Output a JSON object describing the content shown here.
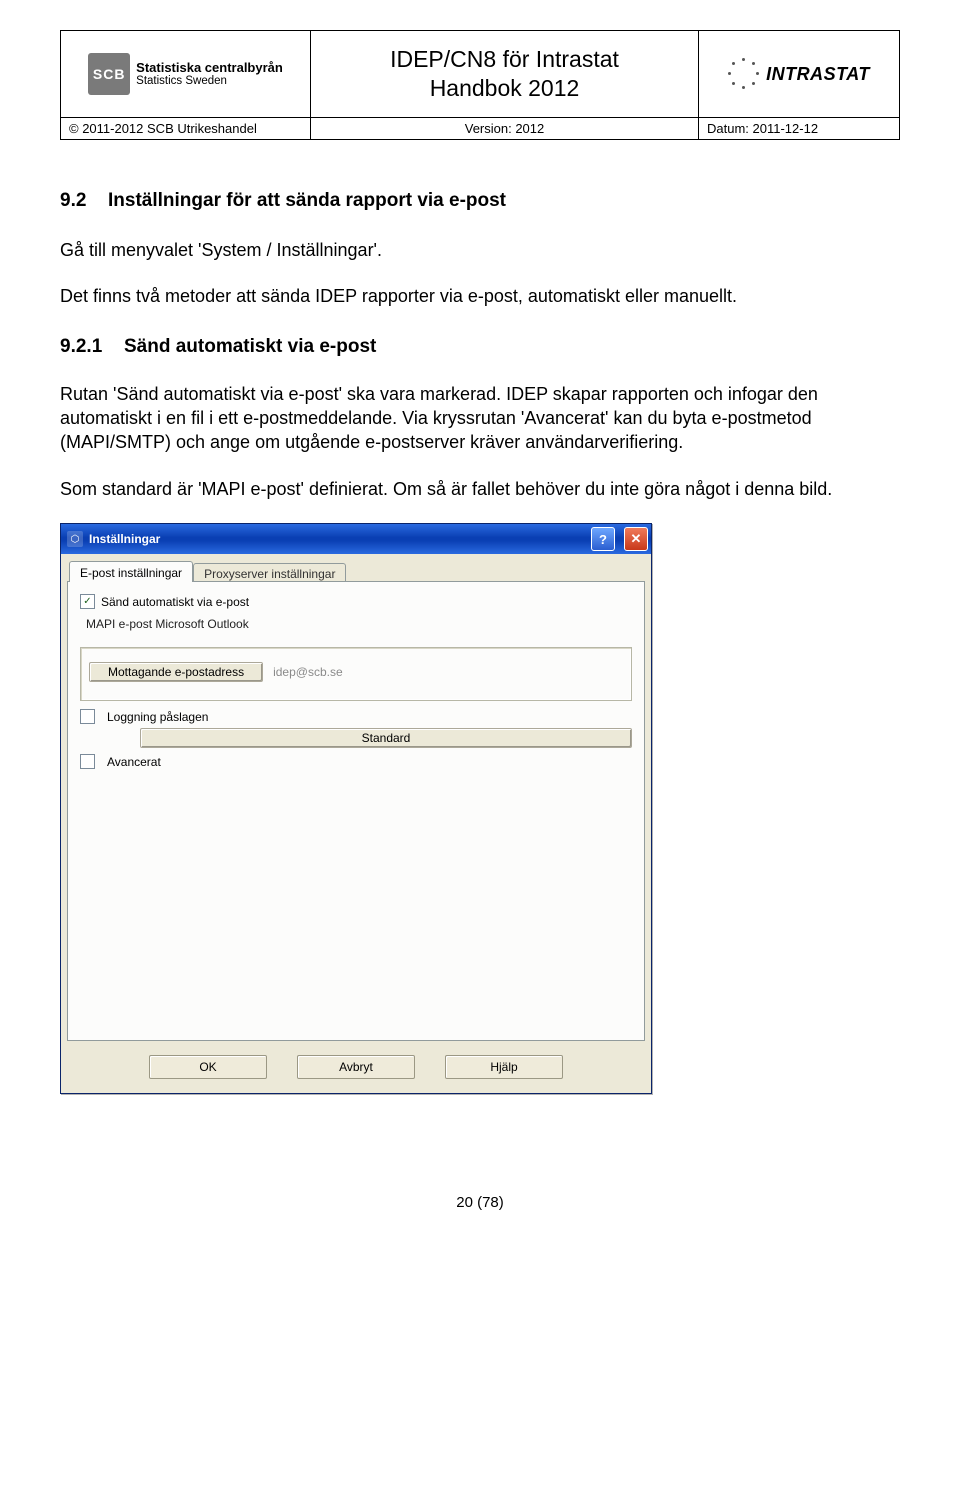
{
  "header": {
    "logo_left": {
      "abbr": "SCB",
      "line1": "Statistiska centralbyrån",
      "line2": "Statistics Sweden"
    },
    "title_line1": "IDEP/CN8 för Intrastat",
    "title_line2": "Handbok 2012",
    "logo_right_text": "INTRASTAT",
    "copyright": "© 2011-2012 SCB Utrikeshandel",
    "version": "Version: 2012",
    "date": "Datum: 2011-12-12"
  },
  "section": {
    "num1": "9.2",
    "title1": "Inställningar för att sända rapport via e-post",
    "p1": "Gå till menyvalet 'System / Inställningar'.",
    "p2": "Det finns två metoder att sända IDEP rapporter via e-post, automatiskt eller manuellt.",
    "num2": "9.2.1",
    "title2": "Sänd automatiskt via e-post",
    "p3": "Rutan 'Sänd automatiskt via e-post' ska vara markerad. IDEP skapar rapporten och infogar den automatiskt i en fil i ett e-postmeddelande. Via kryssrutan 'Avancerat' kan du byta e-postmetod (MAPI/SMTP) och ange om utgående e-postserver kräver användarverifiering.",
    "p4": "Som standard är 'MAPI e-post' definierat. Om så är fallet behöver du inte göra något i denna bild."
  },
  "dialog": {
    "title": "Inställningar",
    "tabs": {
      "t1": "E-post inställningar",
      "t2": "Proxyserver inställningar"
    },
    "send_auto_label": "Sänd automatiskt via e-post",
    "mapi_line": "MAPI e-post Microsoft Outlook",
    "recv_label": "Mottagande e-postadress",
    "recv_value": "idep@scb.se",
    "logging_label": "Loggning påslagen",
    "standard_btn": "Standard",
    "advanced_label": "Avancerat",
    "ok": "OK",
    "cancel": "Avbryt",
    "help": "Hjälp"
  },
  "footer": "20 (78)"
}
